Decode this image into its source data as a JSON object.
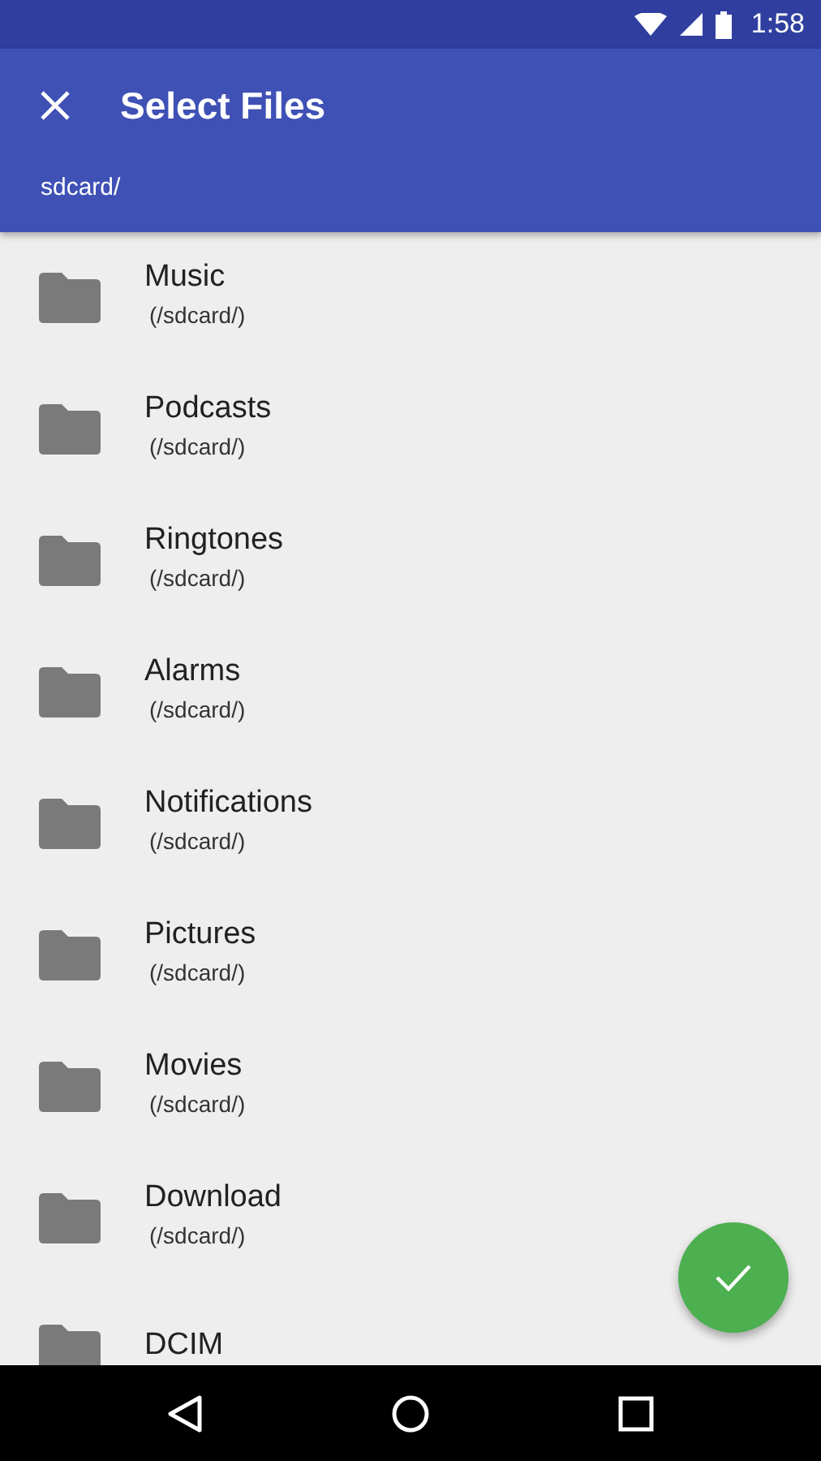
{
  "status_bar": {
    "time": "1:58"
  },
  "toolbar": {
    "title": "Select Files"
  },
  "path": "sdcard/",
  "files": [
    {
      "name": "Music",
      "location": "(/sdcard/)"
    },
    {
      "name": "Podcasts",
      "location": "(/sdcard/)"
    },
    {
      "name": "Ringtones",
      "location": "(/sdcard/)"
    },
    {
      "name": "Alarms",
      "location": "(/sdcard/)"
    },
    {
      "name": "Notifications",
      "location": "(/sdcard/)"
    },
    {
      "name": "Pictures",
      "location": "(/sdcard/)"
    },
    {
      "name": "Movies",
      "location": "(/sdcard/)"
    },
    {
      "name": "Download",
      "location": "(/sdcard/)"
    },
    {
      "name": "DCIM"
    }
  ]
}
